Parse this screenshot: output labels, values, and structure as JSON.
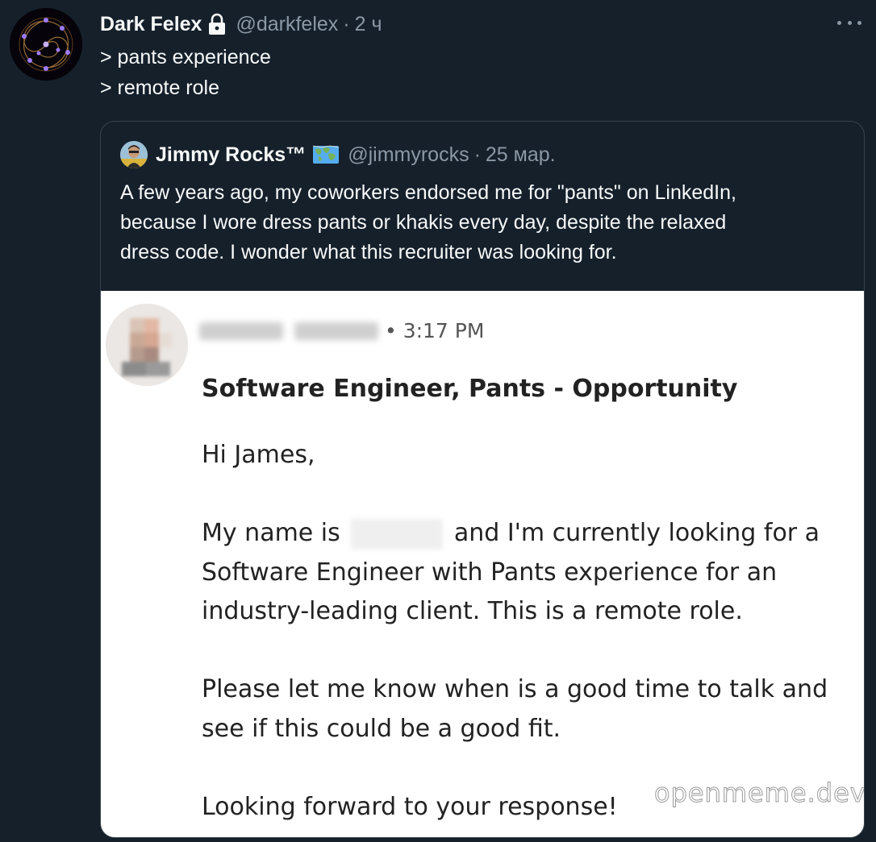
{
  "tweet": {
    "author_name": "Dark Felex",
    "author_handle": "@darkfelex",
    "separator": "·",
    "time": "2 ч",
    "lines": [
      "> pants experience",
      "> remote role"
    ]
  },
  "quoted_tweet": {
    "author_name": "Jimmy Rocks™",
    "author_handle": "@jimmyrocks",
    "separator": "·",
    "date": "25 мар.",
    "lines": [
      "A few years ago, my coworkers endorsed me for \"pants\" on LinkedIn,",
      "because I wore dress pants or khakis every day, despite the relaxed",
      "dress code. I wonder what this recruiter was looking for."
    ]
  },
  "linkedin_message": {
    "time": "• 3:17 PM",
    "subject": "Software Engineer, Pants - Opportunity",
    "greeting": "Hi James,",
    "p1_before": "My name is",
    "p1_after": "and I'm currently looking for a",
    "p1_line2": "Software Engineer with Pants experience for an",
    "p1_line3": "industry-leading client. This is a remote role.",
    "p2_line1": "Please let me know when is a good time to talk and",
    "p2_line2": "see if this could be a good fit.",
    "closing": "Looking forward to your response!"
  },
  "watermark": "openmeme.dev",
  "icons": {
    "lock": "lock-icon",
    "map": "world-map-icon",
    "more": "more-options-icon"
  },
  "colors": {
    "background": "#15202b",
    "text": "#f7f9f9",
    "secondary_text": "#8b98a5",
    "border": "#38444d"
  }
}
